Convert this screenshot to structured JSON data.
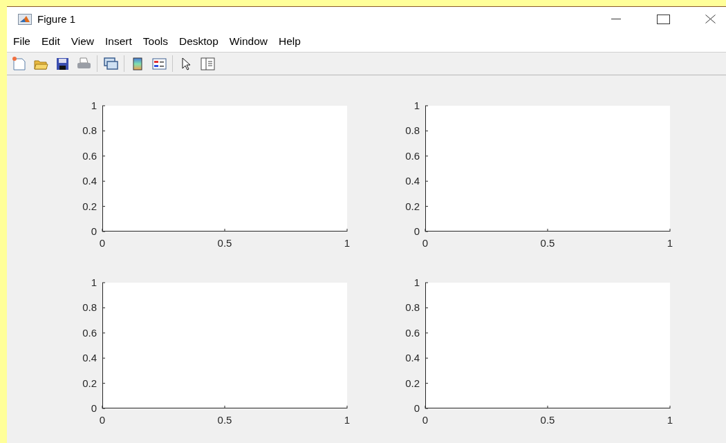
{
  "window": {
    "title": "Figure 1"
  },
  "menu": [
    "File",
    "Edit",
    "View",
    "Insert",
    "Tools",
    "Desktop",
    "Window",
    "Help"
  ],
  "axes": [
    {
      "chart_data": {
        "type": "line",
        "xlim": [
          0,
          1
        ],
        "ylim": [
          0,
          1
        ],
        "xticks": [
          0,
          0.5,
          1
        ],
        "yticks": [
          0,
          0.2,
          0.4,
          0.6,
          0.8,
          1
        ]
      }
    },
    {
      "chart_data": {
        "type": "line",
        "xlim": [
          0,
          1
        ],
        "ylim": [
          0,
          1
        ],
        "xticks": [
          0,
          0.5,
          1
        ],
        "yticks": [
          0,
          0.2,
          0.4,
          0.6,
          0.8,
          1
        ]
      }
    },
    {
      "chart_data": {
        "type": "line",
        "xlim": [
          0,
          1
        ],
        "ylim": [
          0,
          1
        ],
        "xticks": [
          0,
          0.5,
          1
        ],
        "yticks": [
          0,
          0.2,
          0.4,
          0.6,
          0.8,
          1
        ]
      }
    },
    {
      "chart_data": {
        "type": "line",
        "xlim": [
          0,
          1
        ],
        "ylim": [
          0,
          1
        ],
        "xticks": [
          0,
          0.5,
          1
        ],
        "yticks": [
          0,
          0.2,
          0.4,
          0.6,
          0.8,
          1
        ]
      }
    }
  ]
}
